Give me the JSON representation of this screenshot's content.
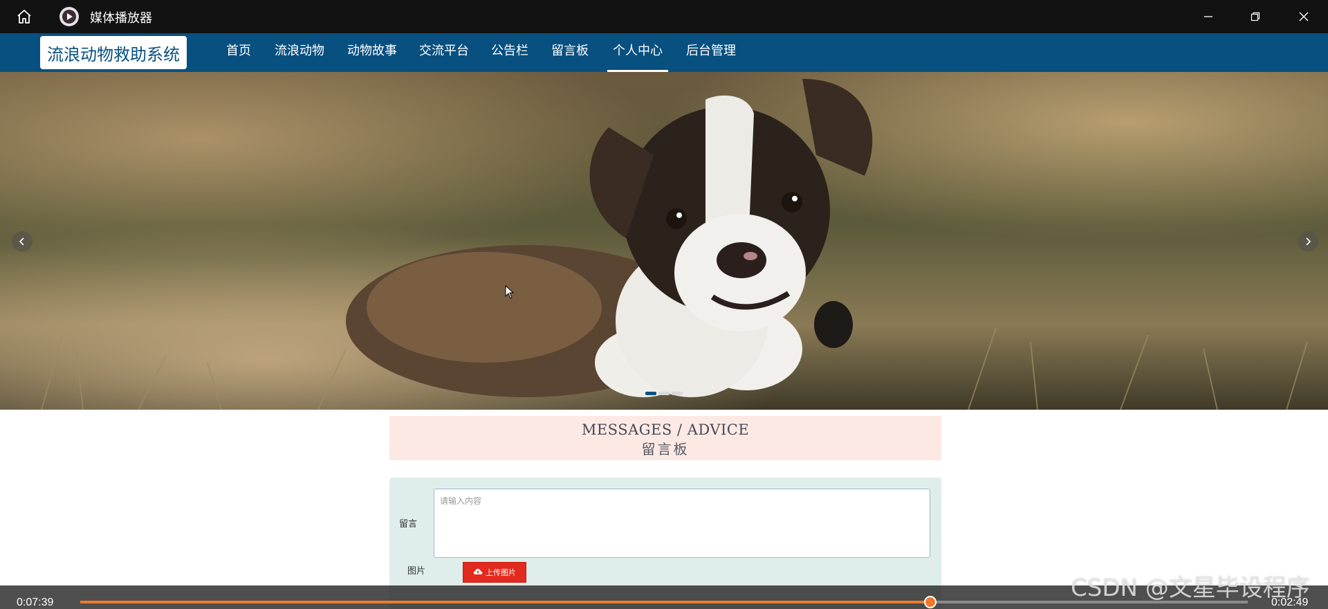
{
  "player": {
    "title": "媒体播放器",
    "current_time": "0:07:39",
    "remaining_time": "0:02:49",
    "progress": 0.728
  },
  "site": {
    "logo_text": "流浪动物救助系统",
    "nav": [
      {
        "label": "首页"
      },
      {
        "label": "流浪动物"
      },
      {
        "label": "动物故事"
      },
      {
        "label": "交流平台"
      },
      {
        "label": "公告栏"
      },
      {
        "label": "留言板"
      },
      {
        "label": "个人中心",
        "active": true
      },
      {
        "label": "后台管理"
      }
    ]
  },
  "banner": {
    "slide_count": 3,
    "active_slide": 1
  },
  "messages": {
    "title_en": "MESSAGES / ADVICE",
    "title_cn": "留言板",
    "message_label": "留言",
    "message_placeholder": "请输入内容",
    "image_label": "图片",
    "upload_button": "上传图片"
  },
  "watermark": "CSDN @文星毕设程序",
  "colors": {
    "nav_bg": "#075080",
    "header_bg": "#fde9e3",
    "form_bg": "#dfeeea",
    "upload_btn": "#e32a1e",
    "progress": "#f07a2a"
  },
  "icons": {
    "home": "home-icon",
    "app": "media-player-icon",
    "minimize": "minimize-icon",
    "restore": "restore-icon",
    "close": "close-icon",
    "prev": "chevron-left-icon",
    "next": "chevron-right-icon",
    "upload": "cloud-upload-icon"
  }
}
